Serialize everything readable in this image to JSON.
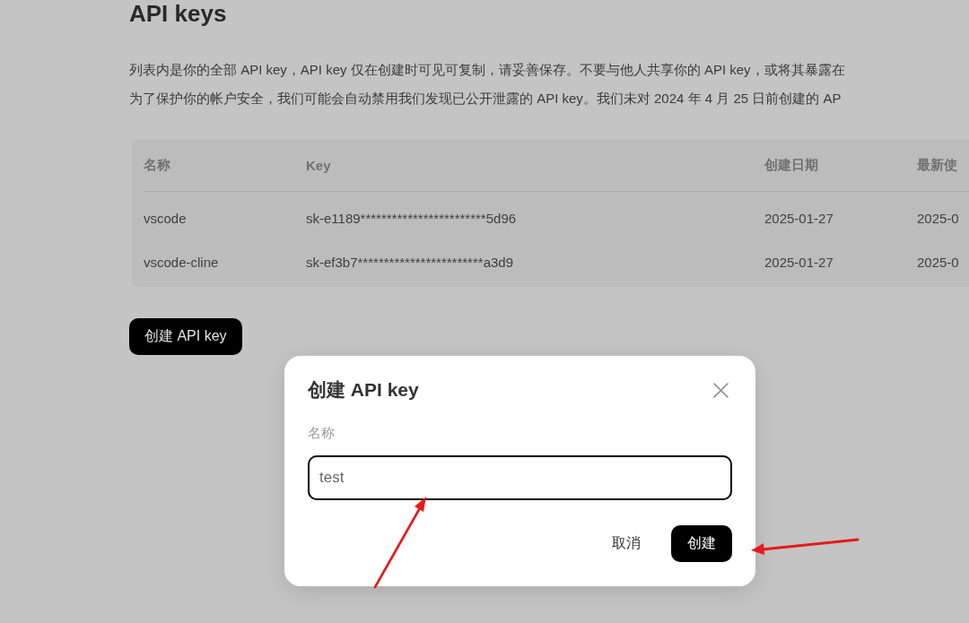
{
  "page": {
    "title": "API keys",
    "description_lines": [
      "列表内是你的全部 API key，API key 仅在创建时可见可复制，请妥善保存。不要与他人共享你的 API key，或将其暴露在",
      "为了保护你的帐户安全，我们可能会自动禁用我们发现已公开泄露的 API key。我们未对 2024 年 4 月 25 日前创建的 AP"
    ]
  },
  "table": {
    "columns": [
      "名称",
      "Key",
      "创建日期",
      "最新使"
    ],
    "rows": [
      [
        "vscode",
        "sk-e1189************************5d96",
        "2025-01-27",
        "2025-0"
      ],
      [
        "vscode-cline",
        "sk-ef3b7************************a3d9",
        "2025-01-27",
        "2025-0"
      ]
    ]
  },
  "create_button": "创建 API key",
  "dialog": {
    "title": "创建 API key",
    "field": {
      "label": "名称",
      "value": "test"
    },
    "buttons": [
      {
        "label": "取消",
        "kind": "secondary"
      },
      {
        "label": "创建",
        "kind": "primary"
      }
    ]
  }
}
